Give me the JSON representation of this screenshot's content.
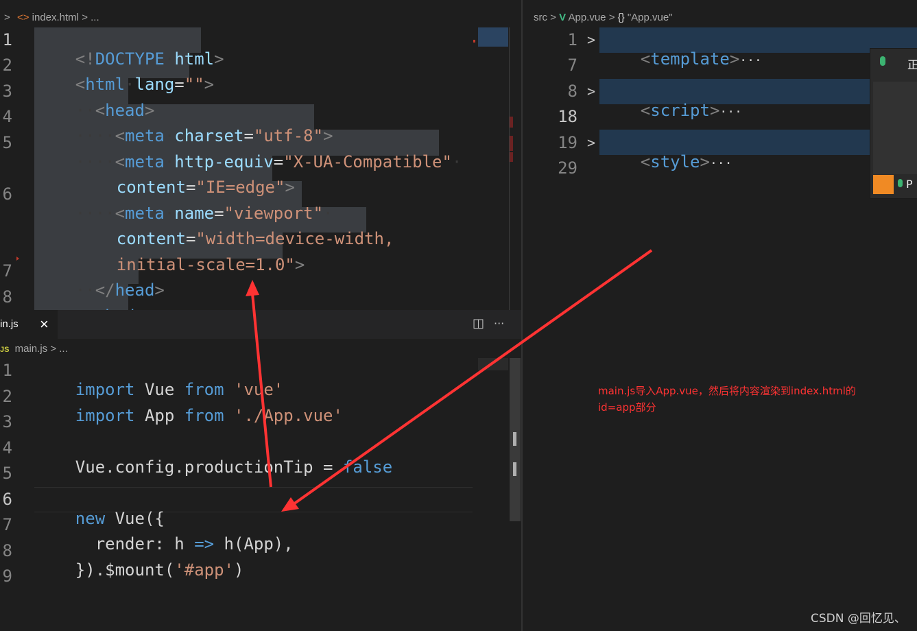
{
  "top_left": {
    "breadcrumb": {
      "chevron": ">",
      "file": "index.html",
      "sep": ">",
      "rest": "..."
    },
    "lines": [
      {
        "n": "1"
      },
      {
        "n": "2"
      },
      {
        "n": "3"
      },
      {
        "n": "4"
      },
      {
        "n": "5"
      },
      {
        "n": "6"
      },
      {
        "n": "7"
      },
      {
        "n": "8"
      }
    ],
    "code": {
      "l1_lt": "<!",
      "l1_doctype": "DOCTYPE",
      "l1_html": "html",
      "l1_gt": ">",
      "l2_lt": "<",
      "l2_tag": "html",
      "l2_attr": "lang",
      "l2_eq": "=",
      "l2_val": "\"\"",
      "l2_gt": ">",
      "l3_lt": "<",
      "l3_tag": "head",
      "l3_gt": ">",
      "l4_lt": "<",
      "l4_tag": "meta",
      "l4_attr": "charset",
      "l4_eq": "=",
      "l4_val": "\"utf-8\"",
      "l4_gt": ">",
      "l5_lt": "<",
      "l5_tag": "meta",
      "l5_attr": "http-equiv",
      "l5_eq": "=",
      "l5_val": "\"X-UA-Compatible\"",
      "l5b_attr": "content",
      "l5b_eq": "=",
      "l5b_val": "\"IE=edge\"",
      "l5b_gt": ">",
      "l6_lt": "<",
      "l6_tag": "meta",
      "l6_attr": "name",
      "l6_eq": "=",
      "l6_val": "\"viewport\"",
      "l6b_attr": "content",
      "l6b_eq": "=",
      "l6b_val": "\"width=device-width,",
      "l6c_val": "initial-scale=1.0\"",
      "l6c_gt": ">",
      "l7_lt": "</",
      "l7_tag": "head",
      "l7_gt": ">",
      "l8_lt": "<",
      "l8_tag": "body",
      "l8_gt": ">"
    }
  },
  "bottom_left": {
    "tab": {
      "label": "in.js",
      "close": "×"
    },
    "actions": {
      "split": "◫",
      "more": "···"
    },
    "breadcrumb": {
      "badge": "JS",
      "file": "main.js",
      "sep": ">",
      "rest": "..."
    },
    "lines": [
      "1",
      "2",
      "3",
      "4",
      "5",
      "6",
      "7",
      "8",
      "9"
    ],
    "code": {
      "l1_kw": "import",
      "l1_id": " Vue ",
      "l1_from": "from",
      "l1_str": " 'vue'",
      "l2_kw": "import",
      "l2_id": " App ",
      "l2_from": "from",
      "l2_str": " './App.vue'",
      "l4_id": "Vue.config.productionTip = ",
      "l4_val": "false",
      "l6_kw": "new",
      "l6_id": " Vue({",
      "l7_a": "  render: h ",
      "l7_arrow": "=>",
      "l7_b": " h(App),",
      "l8_a": "}).$mount(",
      "l8_str": "'#app'",
      "l8_b": ")"
    }
  },
  "right": {
    "breadcrumb": {
      "src": "src",
      "sep1": ">",
      "file": "App.vue",
      "sep2": ">",
      "symbol_icon": "{}",
      "symbol": "\"App.vue\""
    },
    "rows": [
      {
        "n": "1",
        "fold": ">",
        "lt": "<",
        "tag": "template",
        "gt": ">",
        "ell": "···"
      },
      {
        "n": "7"
      },
      {
        "n": "8",
        "fold": ">",
        "lt": "<",
        "tag": "script",
        "gt": ">",
        "ell": "···"
      },
      {
        "n": "18"
      },
      {
        "n": "19",
        "fold": ">",
        "lt": "<",
        "tag": "style",
        "gt": ">",
        "ell": "···"
      },
      {
        "n": "29"
      }
    ],
    "overlay": {
      "text1": "正",
      "text2": "P"
    }
  },
  "annotation": {
    "line1": "main.js导入App.vue，然后将内容渲染到index.html的",
    "line2": "id=app部分",
    "color": "#ff3333"
  },
  "watermark": "CSDN @回忆见、"
}
